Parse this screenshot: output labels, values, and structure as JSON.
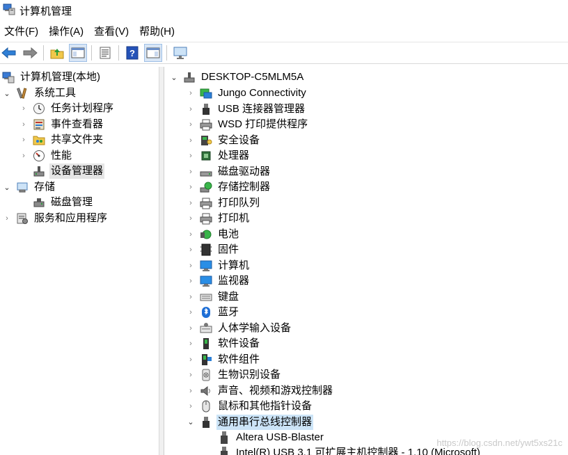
{
  "window": {
    "title": "计算机管理",
    "icon": "computer-management-icon"
  },
  "menu": [
    "文件(F)",
    "操作(A)",
    "查看(V)",
    "帮助(H)"
  ],
  "toolbar": {
    "buttons": [
      "back-arrow-icon",
      "forward-arrow-icon",
      "up-folder-icon",
      "show-hide-tree-icon",
      "properties-icon",
      "help-icon",
      "action-pane-icon",
      "monitor-icon"
    ]
  },
  "left_tree": {
    "root": "计算机管理(本地)",
    "system_tools": "系统工具",
    "task_scheduler": "任务计划程序",
    "event_viewer": "事件查看器",
    "shared_folders": "共享文件夹",
    "performance": "性能",
    "device_manager": "设备管理器",
    "storage": "存储",
    "disk_management": "磁盘管理",
    "services_apps": "服务和应用程序"
  },
  "right_tree": {
    "root": "DESKTOP-C5MLM5A",
    "categories": [
      "Jungo Connectivity",
      "USB 连接器管理器",
      "WSD 打印提供程序",
      "安全设备",
      "处理器",
      "磁盘驱动器",
      "存储控制器",
      "打印队列",
      "打印机",
      "电池",
      "固件",
      "计算机",
      "监视器",
      "键盘",
      "蓝牙",
      "人体学输入设备",
      "软件设备",
      "软件组件",
      "生物识别设备",
      "声音、视频和游戏控制器",
      "鼠标和其他指针设备",
      "通用串行总线控制器"
    ],
    "usb_children": [
      "Altera USB-Blaster",
      "Intel(R) USB 3.1 可扩展主机控制器 - 1.10 (Microsoft)"
    ]
  },
  "watermark": "https://blog.csdn.net/ywt5xs21c"
}
